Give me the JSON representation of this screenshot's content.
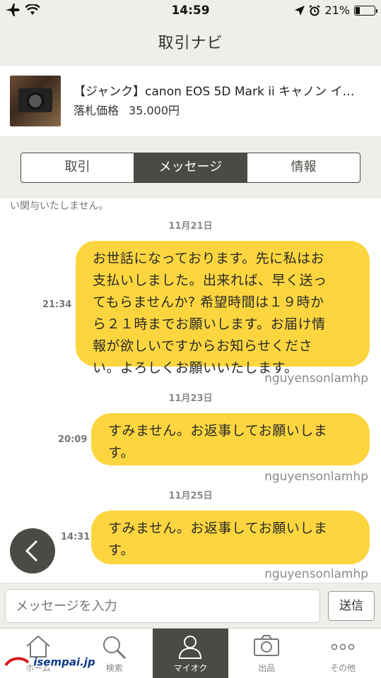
{
  "status_bar": {
    "time": "14:59",
    "battery_percent": "21%",
    "battery_level": 0.21
  },
  "nav": {
    "title": "取引ナビ"
  },
  "item": {
    "title": "【ジャンク】canon EOS 5D Mark ii キャノン イ…",
    "price_label": "落札価格",
    "price_value": "35.000円"
  },
  "segments": [
    {
      "label": "取引",
      "active": false
    },
    {
      "label": "メッセージ",
      "active": true
    },
    {
      "label": "情報",
      "active": false
    }
  ],
  "chat": {
    "cut_text": "い関与いたしません。",
    "messages": [
      {
        "date": "11月21日",
        "time": "21:34",
        "lines": [
          "お世話になっております。先に私はお",
          "支払いしました。出来れば、早く送っ",
          "てもらませんか? 希望時間は１９時か",
          "ら２１時までお願いします。お届け情",
          "報が欲しいですからお知らせくださ",
          "い。よろしくお願いいたします。"
        ],
        "sender": "nguyensonlamhp"
      },
      {
        "date": "11月23日",
        "time": "20:09",
        "lines": [
          "すみません。お返事してお願いしま",
          "す。"
        ],
        "sender": "nguyensonlamhp"
      },
      {
        "date": "11月25日",
        "time": "14:31",
        "lines": [
          "すみません。お返事してお願いしま",
          "す。"
        ],
        "sender": "nguyensonlamhp"
      }
    ]
  },
  "input": {
    "placeholder": "メッセージを入力",
    "send_label": "送信"
  },
  "tabs": [
    {
      "label": "ホーム",
      "icon": "home-icon",
      "active": false
    },
    {
      "label": "検索",
      "icon": "search-icon",
      "active": false
    },
    {
      "label": "マイオク",
      "icon": "person-icon",
      "active": true
    },
    {
      "label": "出品",
      "icon": "camera-icon",
      "active": false
    },
    {
      "label": "その他",
      "icon": "more-icon",
      "active": false
    }
  ],
  "watermark": {
    "brand": "isempai.jp"
  }
}
